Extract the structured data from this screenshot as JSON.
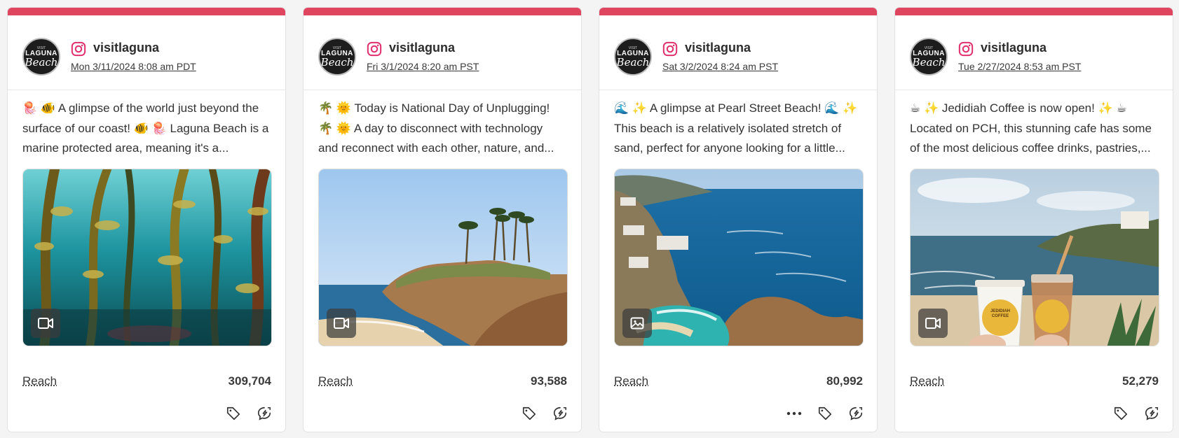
{
  "posts": [
    {
      "account": "visitlaguna",
      "date": "Mon 3/11/2024 8:08 am PDT",
      "caption_lines": [
        "🪼 🐠 A glimpse of the world just beyond the",
        "surface of our coast! 🐠 🪼 Laguna Beach is a",
        "marine protected area, meaning it's a..."
      ],
      "media_type": "video-icon",
      "reach_label": "Reach",
      "reach_value": "309,704",
      "show_more": false
    },
    {
      "account": "visitlaguna",
      "date": "Fri 3/1/2024 8:20 am PST",
      "caption_lines": [
        "🌴 🌞 Today is National Day of Unplugging!",
        "🌴 🌞 A day to disconnect with technology",
        "and reconnect with each other, nature, and..."
      ],
      "media_type": "video-icon",
      "reach_label": "Reach",
      "reach_value": "93,588",
      "show_more": false
    },
    {
      "account": "visitlaguna",
      "date": "Sat 3/2/2024 8:24 am PST",
      "caption_lines": [
        "🌊 ✨ A glimpse at Pearl Street Beach! 🌊 ✨",
        "This beach is a relatively isolated stretch of",
        "sand, perfect for anyone looking for a little..."
      ],
      "media_type": "image-icon",
      "reach_label": "Reach",
      "reach_value": "80,992",
      "show_more": true
    },
    {
      "account": "visitlaguna",
      "date": "Tue 2/27/2024 8:53 am PST",
      "caption_lines": [
        "☕ ✨ Jedidiah Coffee is now open! ✨ ☕",
        "Located on PCH, this stunning cafe has some",
        "of the most delicious coffee drinks, pastries,..."
      ],
      "media_type": "video-icon",
      "reach_label": "Reach",
      "reach_value": "52,279",
      "show_more": false
    }
  ],
  "avatar": {
    "line1": "LAGUNA",
    "line2": "Beach",
    "line3": "VISIT"
  },
  "cup_text": "JEDIDIAH COFFEE",
  "colors": {
    "accent": "#e0455f",
    "instagram": "#e1306c"
  }
}
